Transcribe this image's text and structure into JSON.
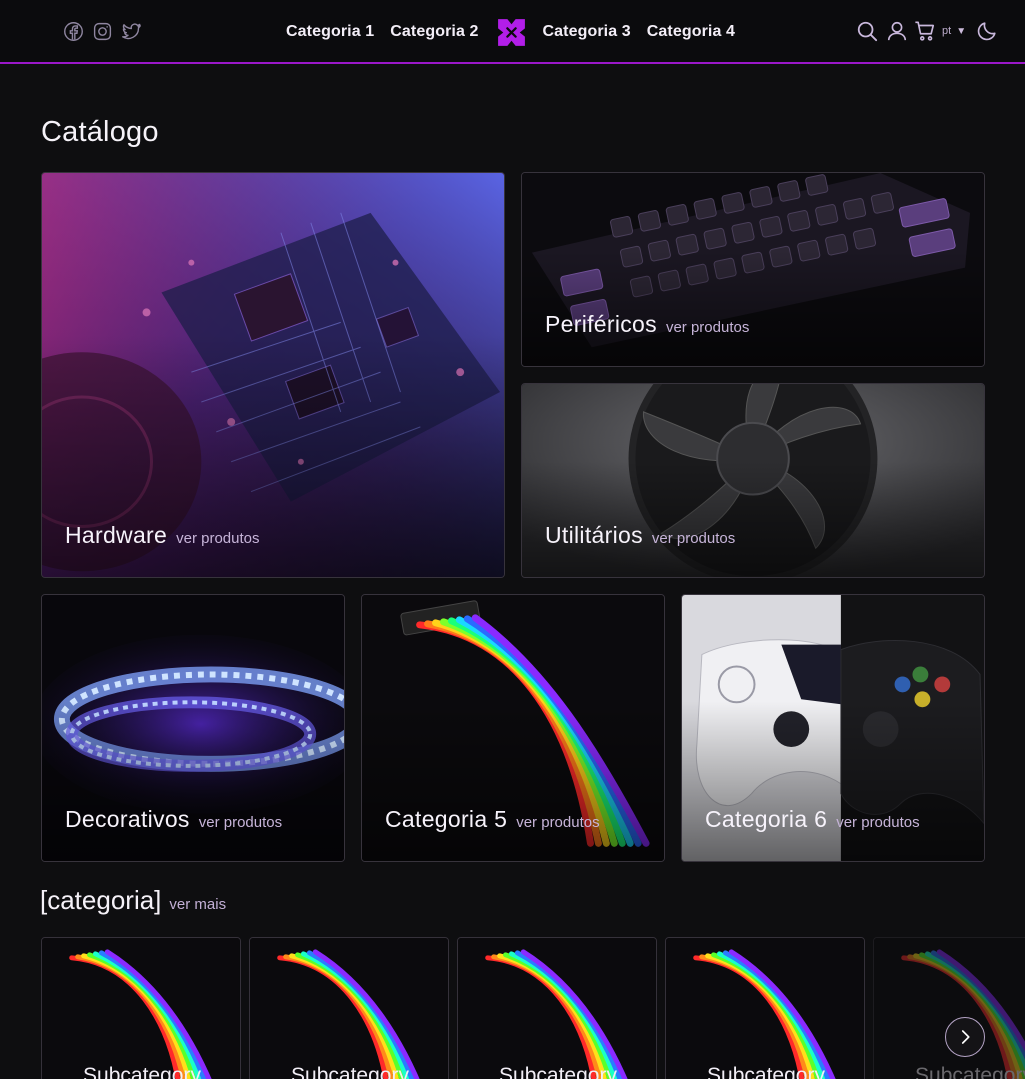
{
  "header": {
    "social": [
      {
        "name": "facebook-icon"
      },
      {
        "name": "instagram-icon"
      },
      {
        "name": "twitter-icon"
      }
    ],
    "nav": [
      "Categoria 1",
      "Categoria 2",
      "Categoria 3",
      "Categoria 4"
    ],
    "logo": "logo-icon",
    "language": "pt",
    "accent": "#9b17c9"
  },
  "catalog": {
    "title": "Catálogo",
    "cards": [
      {
        "title": "Hardware",
        "link": "ver produtos"
      },
      {
        "title": "Periféricos",
        "link": "ver produtos"
      },
      {
        "title": "Utilitários",
        "link": "ver produtos"
      },
      {
        "title": "Decorativos",
        "link": "ver produtos"
      },
      {
        "title": "Categoria 5",
        "link": "ver produtos"
      },
      {
        "title": "Categoria 6",
        "link": "ver produtos"
      }
    ]
  },
  "section": {
    "title": "[categoria]",
    "link": "ver mais",
    "items": [
      "Subcategory",
      "Subcategory",
      "Subcategory",
      "Subcategory",
      "Subcategory"
    ]
  }
}
